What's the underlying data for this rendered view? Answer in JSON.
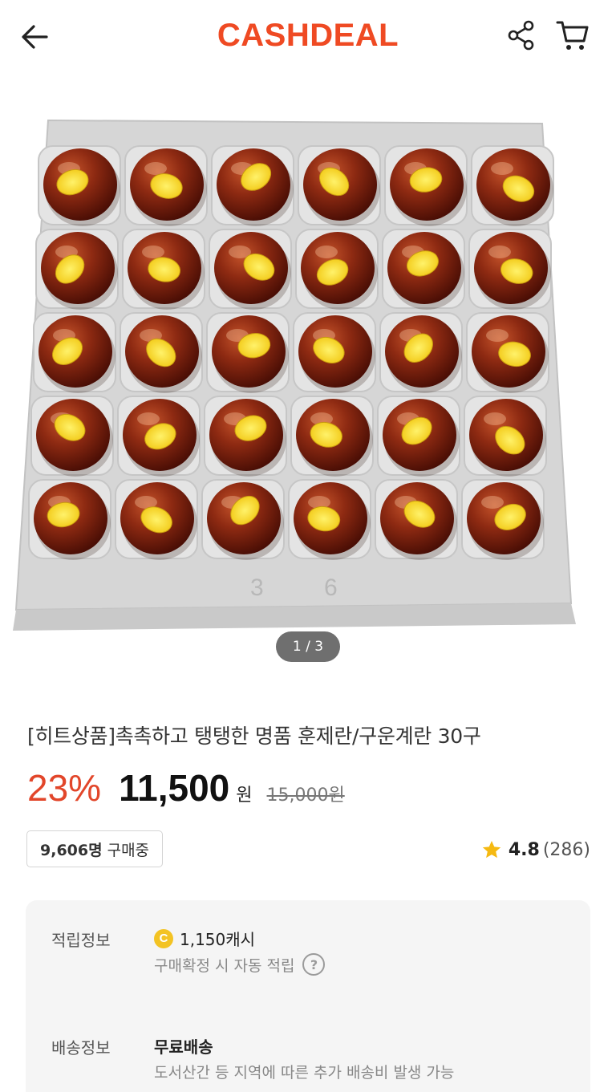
{
  "header": {
    "logo": "CASHDEAL",
    "back_icon": "back-arrow-icon",
    "share_icon": "share-icon",
    "cart_icon": "cart-icon",
    "brand_color": "#ef4a23"
  },
  "gallery": {
    "current": 1,
    "total": 3,
    "indicator": "1 / 3",
    "image_subject": "smoked eggs in 30-egg tray",
    "tray_marks": [
      "3",
      "6"
    ]
  },
  "product": {
    "title": "[히트상품]촉촉하고 탱탱한 명품 훈제란/구운계란 30구",
    "discount": "23%",
    "price": "11,500",
    "currency": "원",
    "original_price": "15,000원",
    "buyers_count": "9,606명",
    "buyers_label": "구매중",
    "rating": "4.8",
    "review_count": "(286)",
    "discount_color": "#e2462a",
    "star_color": "#f5b912"
  },
  "info": {
    "points_label": "적립정보",
    "points_value": "1,150캐시",
    "points_note": "구매확정 시 자동 적립",
    "coin_glyph": "C",
    "help_glyph": "?",
    "shipping_label": "배송정보",
    "shipping_value": "무료배송",
    "shipping_note": "도서산간 등 지역에 따른 추가 배송비 발생 가능"
  }
}
